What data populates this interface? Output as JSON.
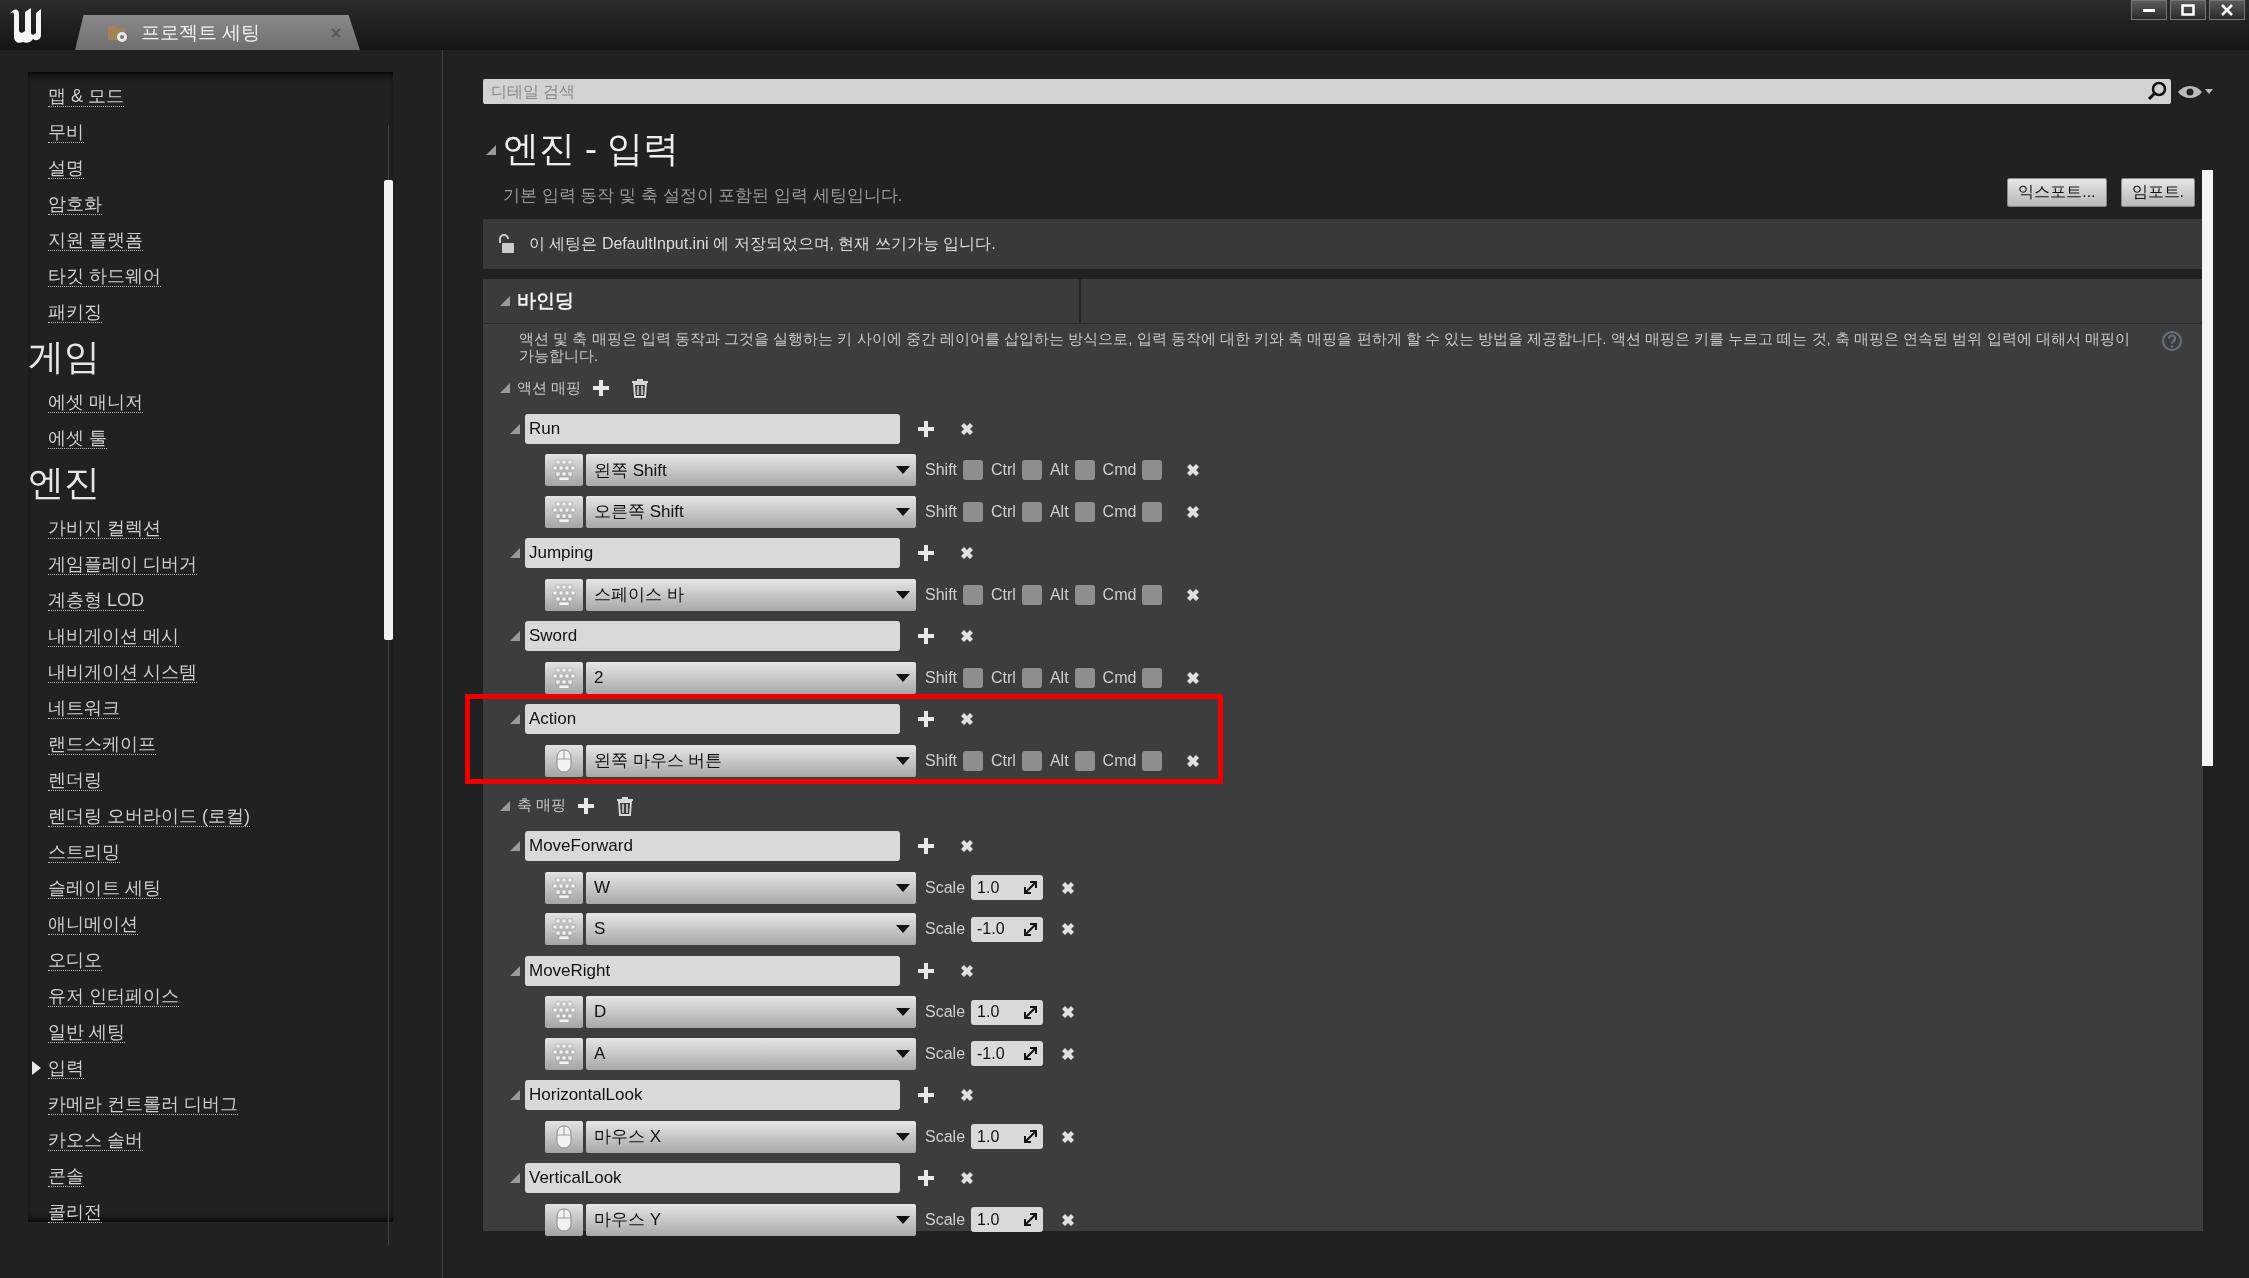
{
  "titlebar": {
    "tab_title": "프로젝트 세팅"
  },
  "sidebar": {
    "items": [
      {
        "kind": "link",
        "label": "맵 & 모드",
        "selected": false
      },
      {
        "kind": "link",
        "label": "무비",
        "selected": false
      },
      {
        "kind": "link",
        "label": "설명",
        "selected": false
      },
      {
        "kind": "link",
        "label": "암호화",
        "selected": false
      },
      {
        "kind": "link",
        "label": "지원 플랫폼",
        "selected": false
      },
      {
        "kind": "link",
        "label": "타깃 하드웨어",
        "selected": false
      },
      {
        "kind": "link",
        "label": "패키징",
        "selected": false
      },
      {
        "kind": "category",
        "label": "게임"
      },
      {
        "kind": "link",
        "label": "에셋 매니저",
        "selected": false
      },
      {
        "kind": "link",
        "label": "에셋 툴",
        "selected": false
      },
      {
        "kind": "category",
        "label": "엔진"
      },
      {
        "kind": "link",
        "label": "가비지 컬렉션",
        "selected": false
      },
      {
        "kind": "link",
        "label": "게임플레이 디버거",
        "selected": false
      },
      {
        "kind": "link",
        "label": "계층형 LOD",
        "selected": false
      },
      {
        "kind": "link",
        "label": "내비게이션 메시",
        "selected": false
      },
      {
        "kind": "link",
        "label": "내비게이션 시스템",
        "selected": false
      },
      {
        "kind": "link",
        "label": "네트워크",
        "selected": false
      },
      {
        "kind": "link",
        "label": "랜드스케이프",
        "selected": false
      },
      {
        "kind": "link",
        "label": "렌더링",
        "selected": false
      },
      {
        "kind": "link",
        "label": "렌더링 오버라이드 (로컬)",
        "selected": false
      },
      {
        "kind": "link",
        "label": "스트리밍",
        "selected": false
      },
      {
        "kind": "link",
        "label": "슬레이트 세팅",
        "selected": false
      },
      {
        "kind": "link",
        "label": "애니메이션",
        "selected": false
      },
      {
        "kind": "link",
        "label": "오디오",
        "selected": false
      },
      {
        "kind": "link",
        "label": "유저 인터페이스",
        "selected": false
      },
      {
        "kind": "link",
        "label": "일반 세팅",
        "selected": false
      },
      {
        "kind": "link",
        "label": "입력",
        "selected": true
      },
      {
        "kind": "link",
        "label": "카메라 컨트롤러 디버그",
        "selected": false
      },
      {
        "kind": "link",
        "label": "카오스 솔버",
        "selected": false
      },
      {
        "kind": "link",
        "label": "콘솔",
        "selected": false
      },
      {
        "kind": "link",
        "label": "콜리전",
        "selected": false
      }
    ]
  },
  "details": {
    "search": {
      "placeholder": "디테일 검색"
    },
    "title": "엔진 - 입력",
    "expanded": true,
    "description": "기본 입력 동작 및 축 설정이 포함된 입력 세팅입니다.",
    "buttons": [
      "익스포트...",
      "임포트."
    ],
    "notice": "이 세팅은 DefaultInput.ini 에 저장되었으며, 현재 쓰기가능 입니다.",
    "sections": [
      {
        "title": "바인딩",
        "expanded": true,
        "description": "액션 및 축 매핑은 입력 동작과 그것을 실행하는 키 사이에 중간 레이어를 삽입하는 방식으로, 입력 동작에 대한 키와 축 매핑을 편하게 할 수 있는 방법을 제공합니다. 액션 매핑은 키를 누르고 떼는 것, 축 매핑은 연속된 범위 입력에 대해서 매핑이 가능합니다.",
        "groups": [
          {
            "kind": "action",
            "label": "액션 매핑",
            "expanded": true,
            "mappings": [
              {
                "name": "Run",
                "expanded": true,
                "highlighted": false,
                "keys": [
                  {
                    "kind": "keyboard",
                    "key": "왼쪽 Shift",
                    "modifiers": [
                      {
                        "label": "Shift",
                        "checked": false
                      },
                      {
                        "label": "Ctrl",
                        "checked": false
                      },
                      {
                        "label": "Alt",
                        "checked": false
                      },
                      {
                        "label": "Cmd",
                        "checked": false
                      }
                    ]
                  },
                  {
                    "kind": "keyboard",
                    "key": "오른쪽 Shift",
                    "modifiers": [
                      {
                        "label": "Shift",
                        "checked": false
                      },
                      {
                        "label": "Ctrl",
                        "checked": false
                      },
                      {
                        "label": "Alt",
                        "checked": false
                      },
                      {
                        "label": "Cmd",
                        "checked": false
                      }
                    ]
                  }
                ]
              },
              {
                "name": "Jumping",
                "expanded": true,
                "highlighted": false,
                "keys": [
                  {
                    "kind": "keyboard",
                    "key": "스페이스 바",
                    "modifiers": [
                      {
                        "label": "Shift",
                        "checked": false
                      },
                      {
                        "label": "Ctrl",
                        "checked": false
                      },
                      {
                        "label": "Alt",
                        "checked": false
                      },
                      {
                        "label": "Cmd",
                        "checked": false
                      }
                    ]
                  }
                ]
              },
              {
                "name": "Sword",
                "expanded": true,
                "highlighted": false,
                "keys": [
                  {
                    "kind": "keyboard",
                    "key": "2",
                    "modifiers": [
                      {
                        "label": "Shift",
                        "checked": false
                      },
                      {
                        "label": "Ctrl",
                        "checked": false
                      },
                      {
                        "label": "Alt",
                        "checked": false
                      },
                      {
                        "label": "Cmd",
                        "checked": false
                      }
                    ]
                  }
                ]
              },
              {
                "name": "Action",
                "expanded": true,
                "highlighted": true,
                "keys": [
                  {
                    "kind": "mouse",
                    "key": "왼쪽 마우스 버튼",
                    "modifiers": [
                      {
                        "label": "Shift",
                        "checked": false
                      },
                      {
                        "label": "Ctrl",
                        "checked": false
                      },
                      {
                        "label": "Alt",
                        "checked": false
                      },
                      {
                        "label": "Cmd",
                        "checked": false
                      }
                    ]
                  }
                ]
              }
            ]
          },
          {
            "kind": "axis",
            "label": "축 매핑",
            "expanded": true,
            "mappings": [
              {
                "name": "MoveForward",
                "expanded": true,
                "highlighted": false,
                "keys": [
                  {
                    "kind": "keyboard",
                    "key": "W",
                    "scale_label": "Scale",
                    "scale": "1.0"
                  },
                  {
                    "kind": "keyboard",
                    "key": "S",
                    "scale_label": "Scale",
                    "scale": "-1.0"
                  }
                ]
              },
              {
                "name": "MoveRight",
                "expanded": true,
                "highlighted": false,
                "keys": [
                  {
                    "kind": "keyboard",
                    "key": "D",
                    "scale_label": "Scale",
                    "scale": "1.0"
                  },
                  {
                    "kind": "keyboard",
                    "key": "A",
                    "scale_label": "Scale",
                    "scale": "-1.0"
                  }
                ]
              },
              {
                "name": "HorizontalLook",
                "expanded": true,
                "highlighted": false,
                "keys": [
                  {
                    "kind": "mouse",
                    "key": "마우스 X",
                    "scale_label": "Scale",
                    "scale": "1.0"
                  }
                ]
              },
              {
                "name": "VerticalLook",
                "expanded": true,
                "highlighted": false,
                "keys": [
                  {
                    "kind": "mouse",
                    "key": "마우스 Y",
                    "scale_label": "Scale",
                    "scale": "1.0"
                  }
                ]
              }
            ]
          }
        ]
      }
    ]
  }
}
